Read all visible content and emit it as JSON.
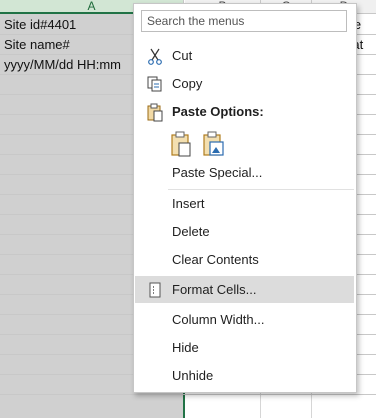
{
  "spreadsheet": {
    "columns": [
      "A",
      "B",
      "C",
      "D"
    ],
    "cells": {
      "a1": "Site id#4401",
      "a2": "Site name#",
      "a3": "yyyy/MM/dd HH:mm",
      "d1_partial": "me",
      "d2_partial": "wat"
    },
    "selection_color": "#217346"
  },
  "context_menu": {
    "search_placeholder": "Search the menus",
    "items": [
      {
        "id": "cut",
        "label": "Cut",
        "icon": "scissors-icon"
      },
      {
        "id": "copy",
        "label": "Copy",
        "icon": "copy-icon"
      },
      {
        "id": "paste_options",
        "label": "Paste Options:",
        "icon": "clipboard-icon"
      },
      {
        "id": "paste_special",
        "label": "Paste Special..."
      },
      {
        "id": "insert",
        "label": "Insert"
      },
      {
        "id": "delete",
        "label": "Delete"
      },
      {
        "id": "clear_contents",
        "label": "Clear Contents"
      },
      {
        "id": "format_cells",
        "label": "Format Cells...",
        "icon": "format-cells-icon",
        "highlighted": true
      },
      {
        "id": "column_width",
        "label": "Column Width..."
      },
      {
        "id": "hide",
        "label": "Hide"
      },
      {
        "id": "unhide",
        "label": "Unhide"
      }
    ],
    "paste_buttons": [
      "paste-icon",
      "paste-picture-icon"
    ]
  }
}
